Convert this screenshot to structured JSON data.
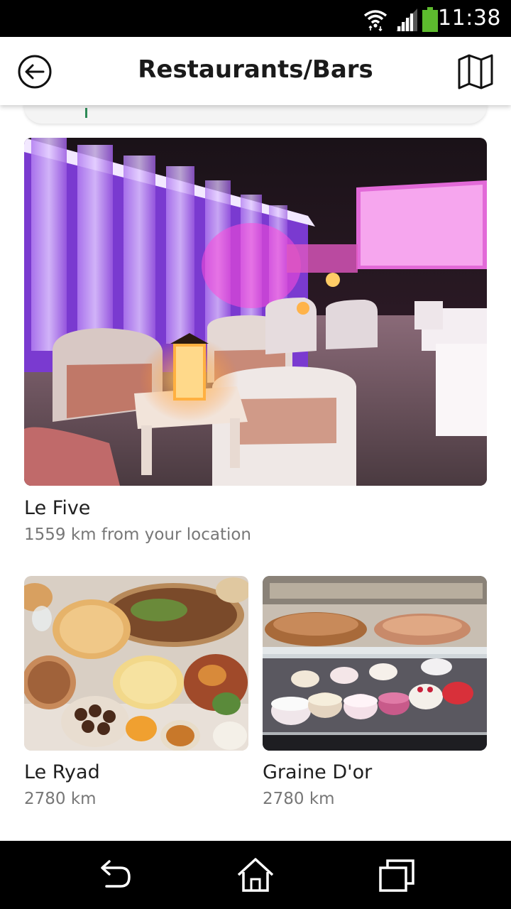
{
  "status_bar": {
    "time": "11:38",
    "icons": [
      "wifi-icon",
      "signal-icon",
      "battery-icon"
    ],
    "battery_color": "#5dbb2e"
  },
  "app_bar": {
    "title": "Restaurants/Bars",
    "back_icon": "back-arrow-circle-icon",
    "map_icon": "map-icon"
  },
  "accent_color": "#2e8b57",
  "places": [
    {
      "name": "Le Five",
      "distance": "1559 km from your location",
      "image": "rooftop lounge photo"
    },
    {
      "name": "Le Ryad",
      "distance": "2780 km",
      "image": "moroccan food spread photo"
    },
    {
      "name": "Graine D'or",
      "distance": "2780 km",
      "image": "pastry display case photo"
    }
  ],
  "nav_bar": {
    "buttons": [
      "back-icon",
      "home-icon",
      "recents-icon"
    ]
  }
}
